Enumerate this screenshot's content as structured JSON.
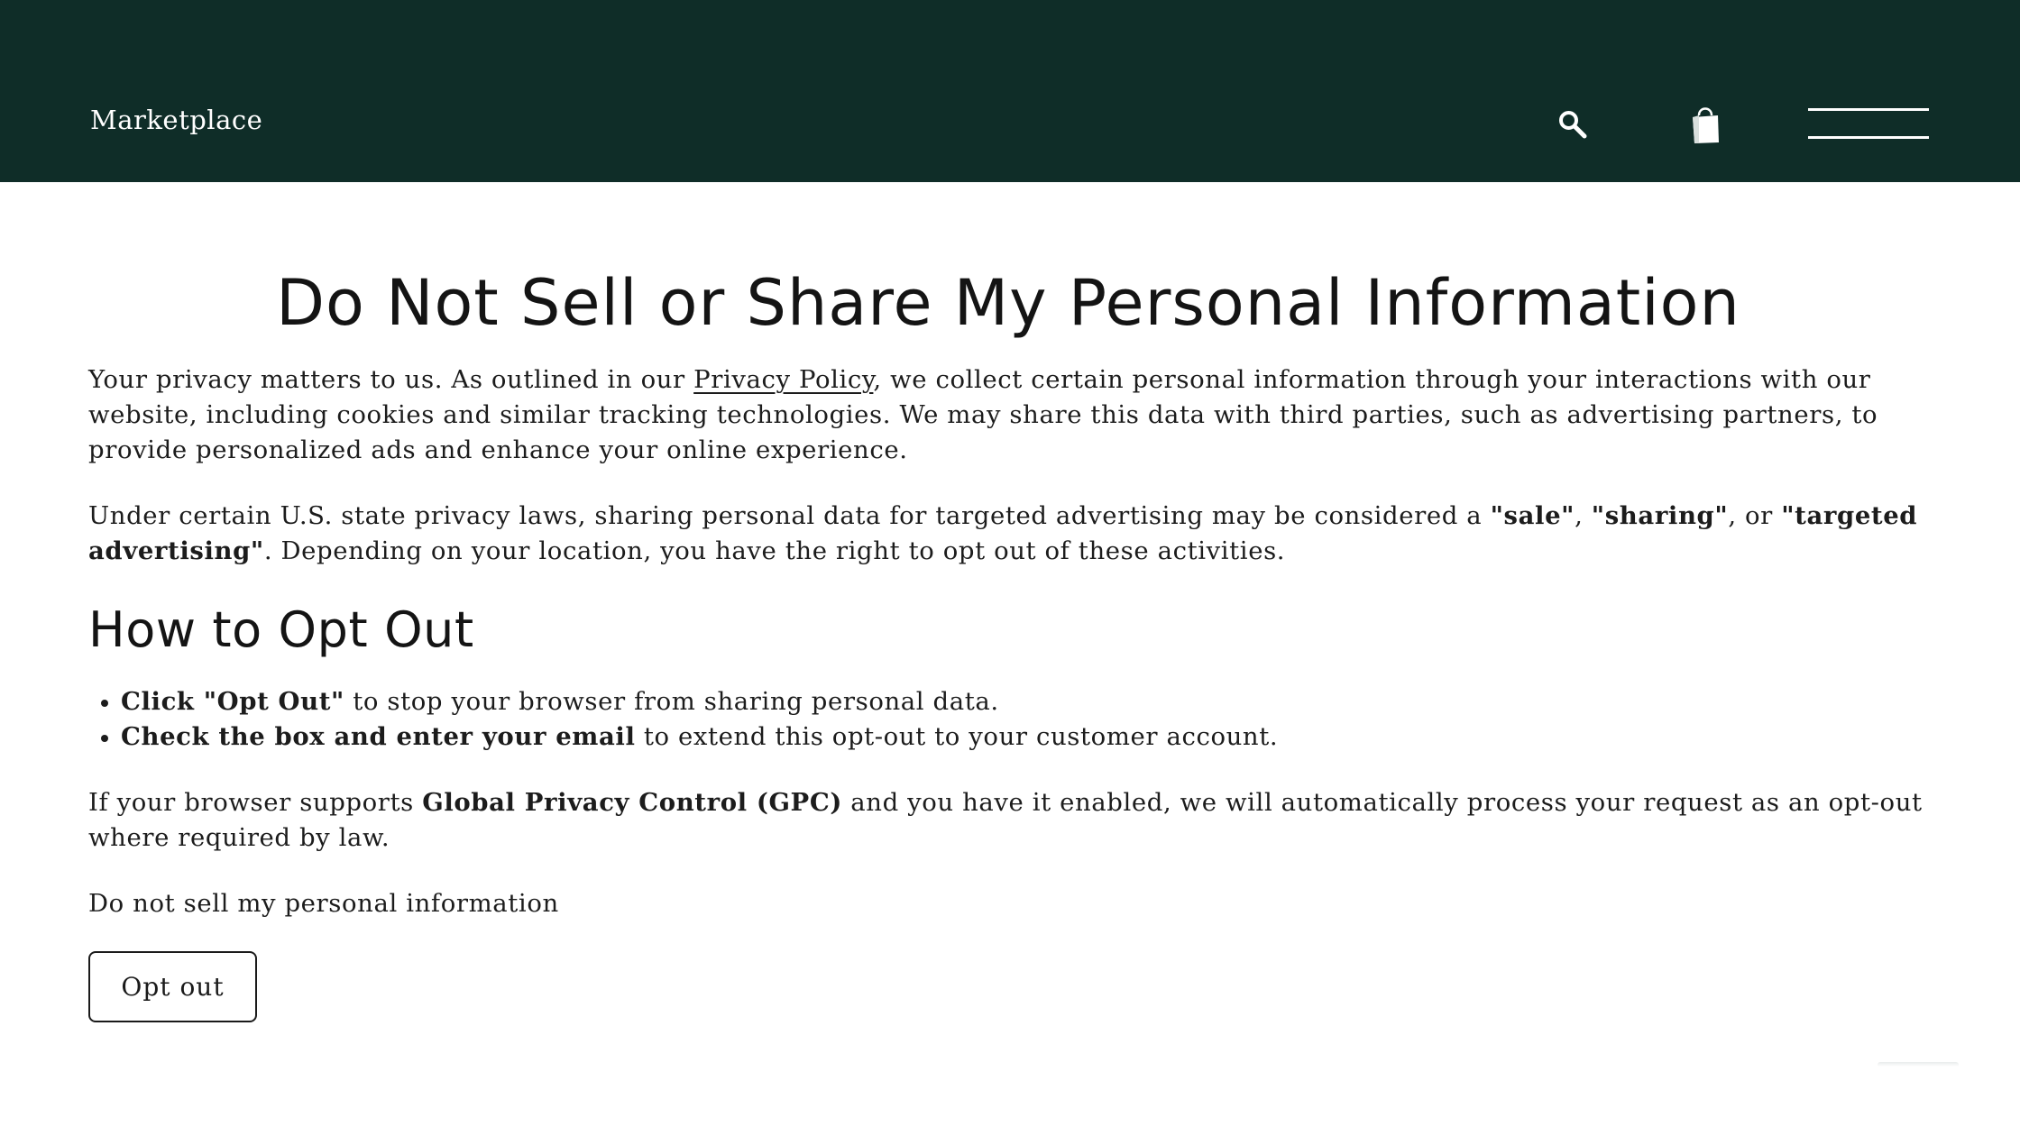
{
  "header": {
    "brand": "Marketplace",
    "icons": [
      "search-icon",
      "shopping-bag-icon",
      "menu-icon"
    ],
    "background_color": "#0f2d28"
  },
  "main": {
    "title": "Do Not Sell or Share My Personal Information",
    "intro": {
      "before_link": "Your privacy matters to us. As outlined in our ",
      "link_text": "Privacy Policy",
      "after_link": ", we collect certain personal information through your interactions with our website, including cookies and similar tracking technologies. We may share this data with third parties, such as advertising partners, to provide personalized ads and enhance your online experience."
    },
    "laws": {
      "text_1": "Under certain U.S. state privacy laws, sharing personal data for targeted advertising may be considered a ",
      "term_1": "\"sale\"",
      "text_2": ", ",
      "term_2": "\"sharing\"",
      "text_3": ", or ",
      "term_3": "\"targeted advertising\"",
      "text_4": ". Depending on your location, you have the right to opt out of these activities."
    },
    "how_to_heading": "How to Opt Out",
    "steps": [
      {
        "bold": "Click \"Opt Out\"",
        "rest": " to stop your browser from sharing personal data."
      },
      {
        "bold": "Check the box and enter your email",
        "rest": " to extend this opt-out to your customer account."
      }
    ],
    "gpc": {
      "text_1": "If your browser supports ",
      "term": "Global Privacy Control (GPC)",
      "text_2": " and you have it enabled, we will automatically process your request as an opt-out where required by law."
    },
    "status_text": "Do not sell my personal information",
    "opt_out_button": "Opt out"
  }
}
